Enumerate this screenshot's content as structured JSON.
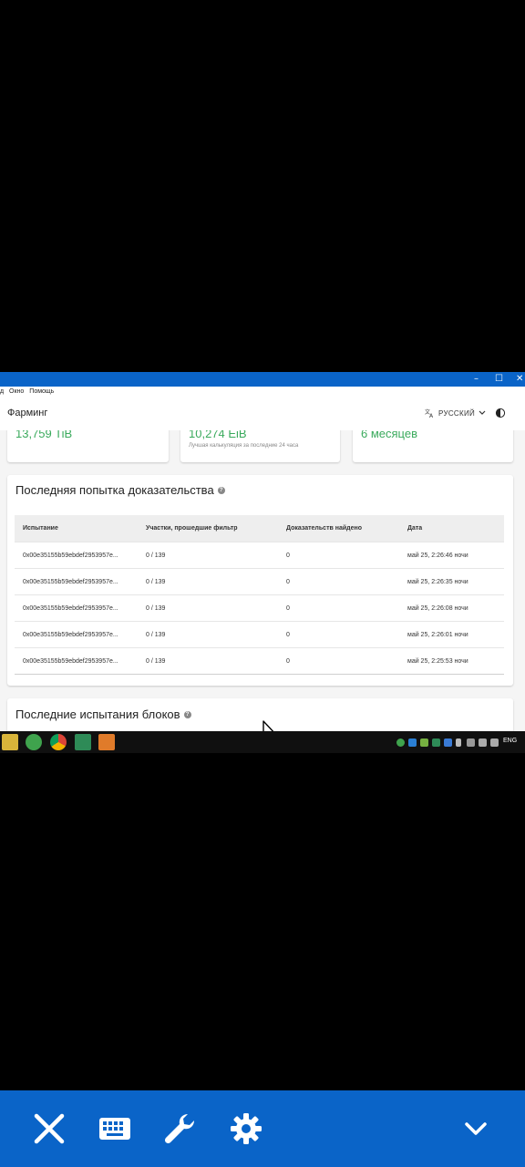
{
  "menu": [
    "д",
    "Окно",
    "Помощь"
  ],
  "window_controls": {
    "minimize": "–",
    "maximize": "☐",
    "close": "✕"
  },
  "appbar": {
    "title": "Фарминг",
    "language": "РУССКИЙ"
  },
  "stats": [
    {
      "value": "13,759 TiB",
      "sub": ""
    },
    {
      "value": "10,274 EiB",
      "sub": "Лучшая калькуляция за последние 24 часа"
    },
    {
      "value": "6 месяцев",
      "sub": ""
    }
  ],
  "proofs": {
    "title": "Последняя попытка доказательства",
    "columns": [
      "Испытание",
      "Участки, прошедшие фильтр",
      "Доказательств найдено",
      "Дата"
    ],
    "rows": [
      [
        "0x00e35155b59ebdef2953957e...",
        "0 / 139",
        "0",
        "май 25, 2:26:46 ночи"
      ],
      [
        "0x00e35155b59ebdef2953957e...",
        "0 / 139",
        "0",
        "май 25, 2:26:35 ночи"
      ],
      [
        "0x00e35155b59ebdef2953957e...",
        "0 / 139",
        "0",
        "май 25, 2:26:08 ночи"
      ],
      [
        "0x00e35155b59ebdef2953957e...",
        "0 / 139",
        "0",
        "май 25, 2:26:01 ночи"
      ],
      [
        "0x00e35155b59ebdef2953957e...",
        "0 / 139",
        "0",
        "май 25, 2:25:53 ночи"
      ]
    ]
  },
  "blocks": {
    "title": "Последние испытания блоков"
  },
  "taskbar": {
    "lang": "ENG"
  },
  "colors": {
    "accent": "#0a64c8",
    "value_green": "#3aaa5c"
  }
}
